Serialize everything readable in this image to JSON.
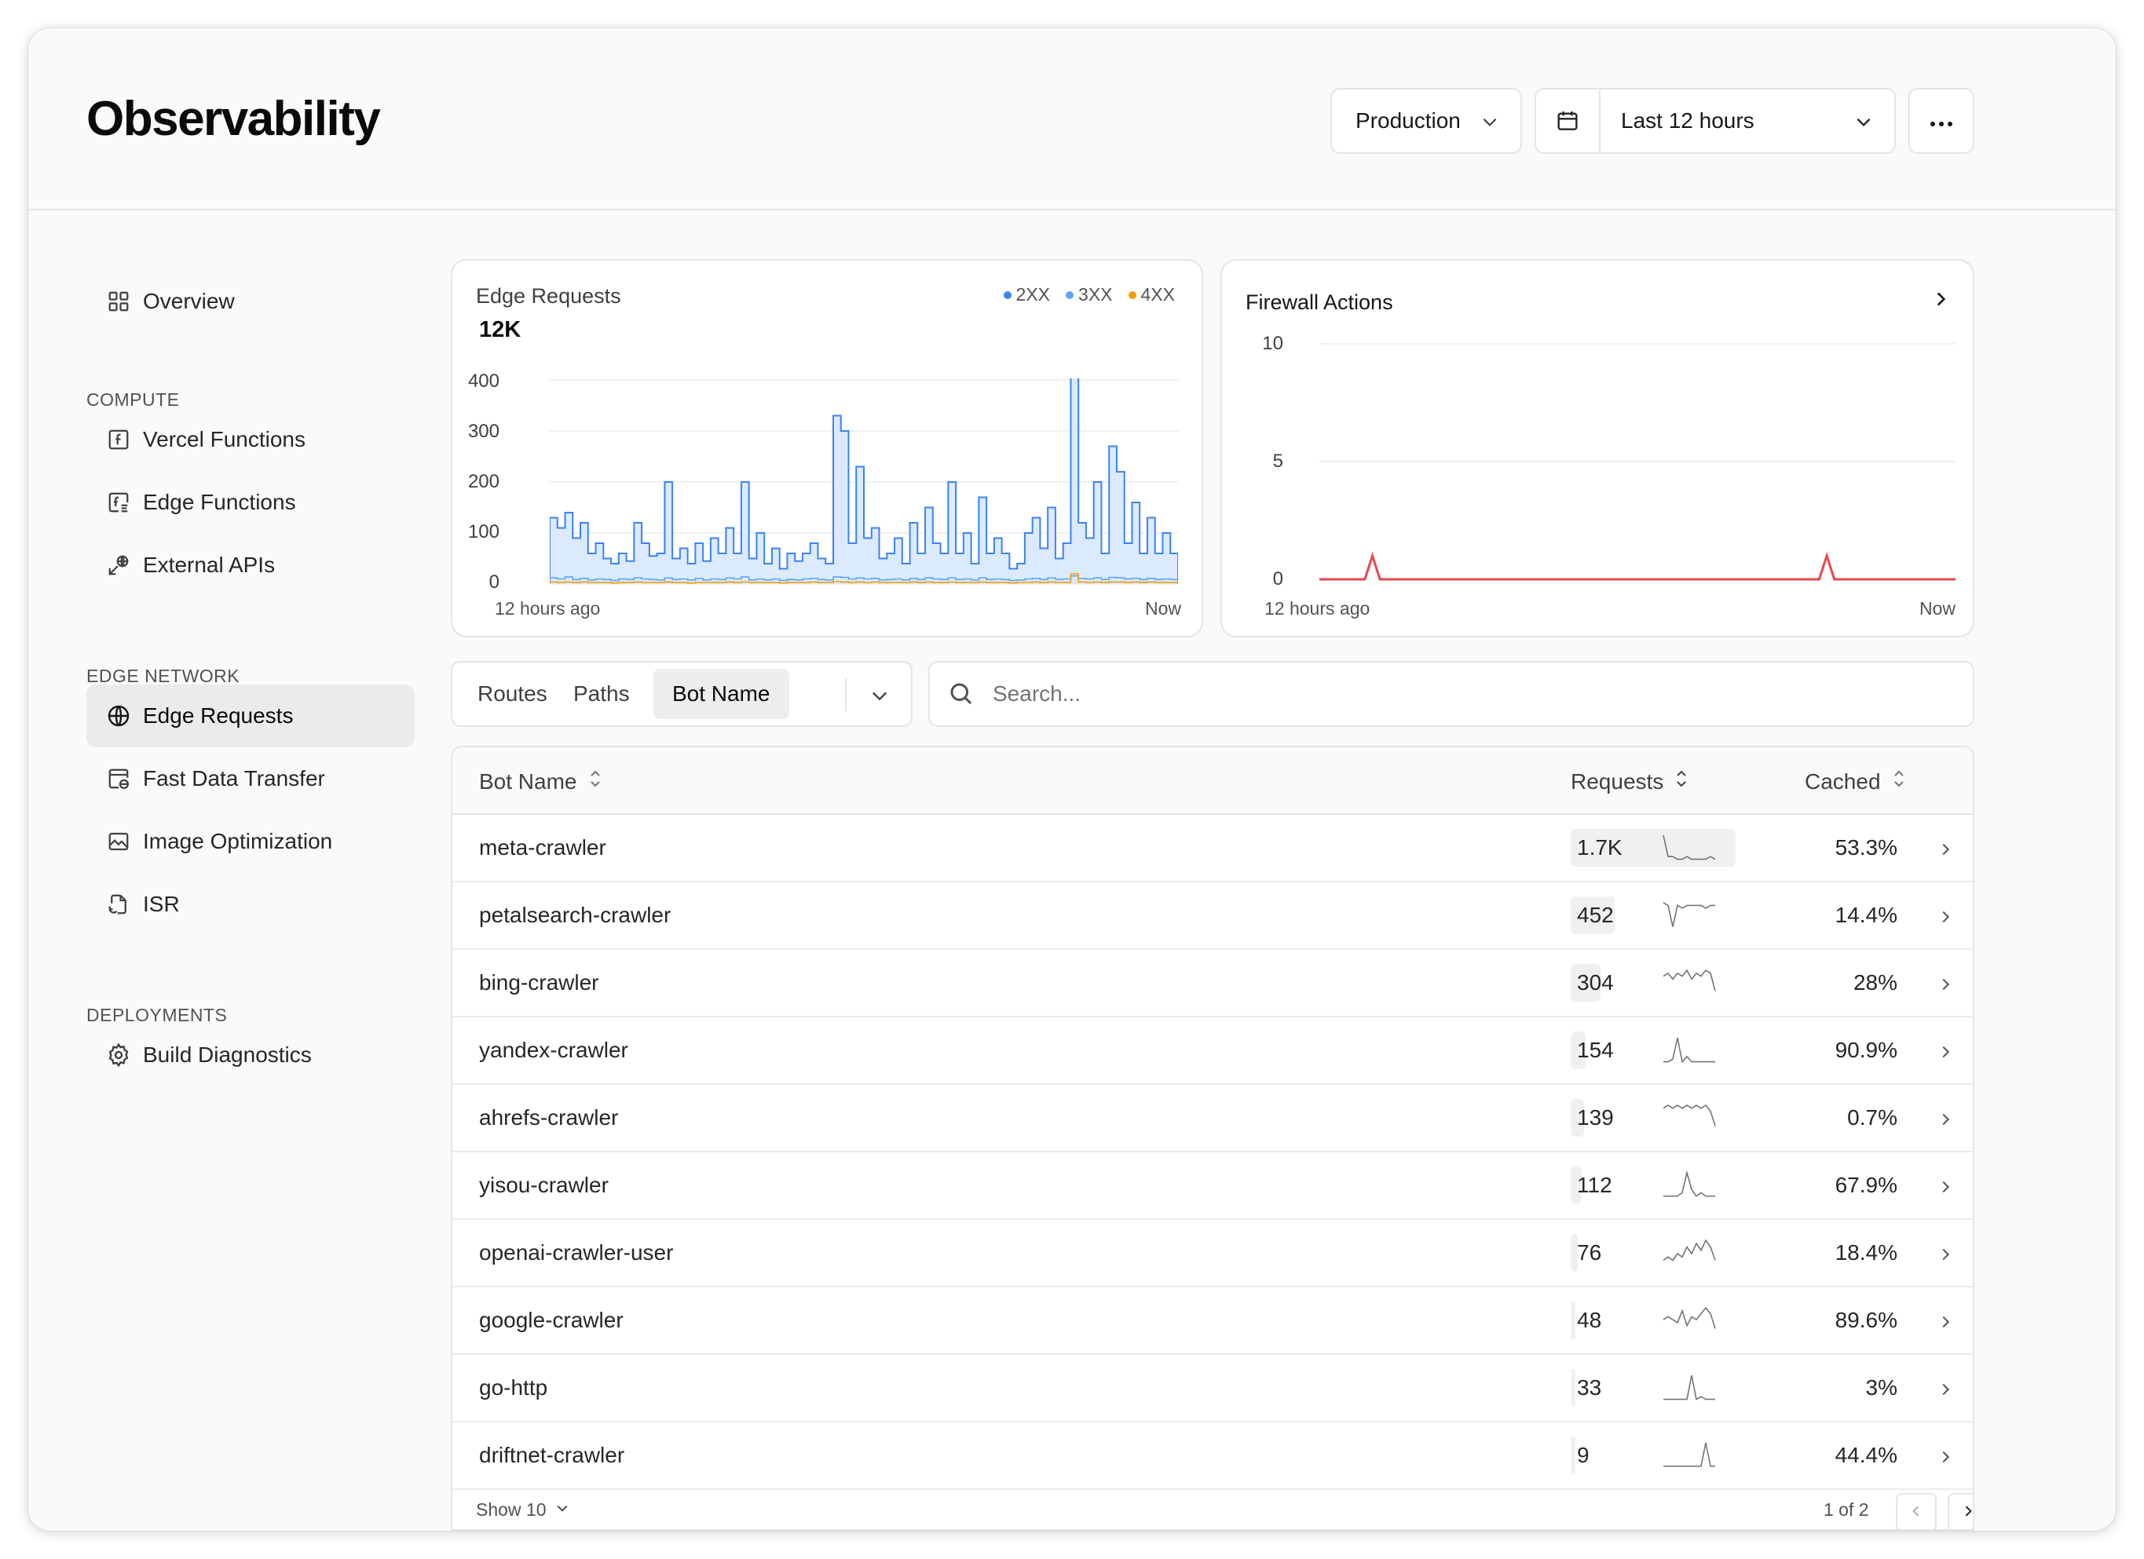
{
  "header": {
    "title": "Observability",
    "environment": "Production",
    "time_range": "Last 12 hours"
  },
  "sidebar": {
    "overview": "Overview",
    "sections": [
      {
        "label": "COMPUTE",
        "items": [
          "Vercel Functions",
          "Edge Functions",
          "External APIs"
        ]
      },
      {
        "label": "EDGE NETWORK",
        "items": [
          "Edge Requests",
          "Fast Data Transfer",
          "Image Optimization",
          "ISR"
        ]
      },
      {
        "label": "DEPLOYMENTS",
        "items": [
          "Build Diagnostics"
        ]
      }
    ],
    "active": "Edge Requests"
  },
  "edge_chart": {
    "title": "Edge Requests",
    "total": "12K",
    "legend": [
      {
        "label": "2XX",
        "color": "#3b82f6"
      },
      {
        "label": "3XX",
        "color": "#60a5fa"
      },
      {
        "label": "4XX",
        "color": "#f59e0b"
      }
    ],
    "y_ticks": [
      "400",
      "300",
      "200",
      "100",
      "0"
    ],
    "x_start": "12 hours ago",
    "x_end": "Now"
  },
  "firewall_chart": {
    "title": "Firewall Actions",
    "y_ticks": [
      "10",
      "5",
      "0"
    ],
    "x_start": "12 hours ago",
    "x_end": "Now",
    "color": "#e5484d"
  },
  "chart_data": [
    {
      "type": "area",
      "title": "Edge Requests",
      "ylim": [
        0,
        400
      ],
      "series": [
        {
          "name": "2XX",
          "values": [
            130,
            110,
            140,
            90,
            120,
            60,
            80,
            50,
            40,
            60,
            45,
            120,
            80,
            55,
            60,
            200,
            50,
            70,
            40,
            80,
            45,
            90,
            60,
            110,
            60,
            200,
            50,
            100,
            40,
            70,
            30,
            60,
            45,
            60,
            80,
            50,
            40,
            330,
            300,
            80,
            230,
            90,
            110,
            50,
            60,
            90,
            40,
            120,
            60,
            150,
            80,
            60,
            200,
            60,
            100,
            40,
            170,
            60,
            90,
            60,
            30,
            40,
            100,
            130,
            70,
            150,
            50,
            80,
            410,
            120,
            90,
            200,
            60,
            270,
            220,
            80,
            160,
            60,
            130,
            60,
            100,
            60
          ]
        },
        {
          "name": "3XX",
          "values": [
            12,
            10,
            14,
            9,
            11,
            8,
            10,
            9,
            7,
            10,
            9,
            12,
            10,
            9,
            8,
            12,
            9,
            10,
            8,
            11,
            8,
            10,
            9,
            12,
            10,
            14,
            8,
            10,
            8,
            10,
            7,
            9,
            8,
            10,
            11,
            9,
            8,
            14,
            13,
            10,
            12,
            10,
            11,
            8,
            9,
            10,
            8,
            11,
            9,
            12,
            10,
            9,
            12,
            9,
            10,
            8,
            12,
            9,
            10,
            9,
            7,
            8,
            10,
            11,
            9,
            12,
            9,
            10,
            16,
            11,
            10,
            12,
            9,
            13,
            12,
            10,
            11,
            9,
            11,
            9,
            10,
            9
          ]
        },
        {
          "name": "4XX",
          "values": [
            4,
            3,
            4,
            3,
            4,
            3,
            3,
            3,
            2,
            3,
            3,
            4,
            3,
            3,
            3,
            4,
            3,
            3,
            2,
            3,
            3,
            3,
            3,
            4,
            3,
            4,
            3,
            3,
            3,
            3,
            2,
            3,
            3,
            3,
            4,
            3,
            3,
            5,
            4,
            3,
            4,
            3,
            4,
            3,
            3,
            3,
            3,
            4,
            3,
            4,
            3,
            3,
            4,
            3,
            3,
            3,
            4,
            3,
            3,
            3,
            2,
            3,
            3,
            4,
            3,
            4,
            3,
            3,
            20,
            4,
            3,
            4,
            3,
            4,
            4,
            3,
            4,
            3,
            4,
            3,
            3,
            3
          ]
        }
      ]
    },
    {
      "type": "line",
      "title": "Firewall Actions",
      "ylim": [
        0,
        10
      ],
      "series": [
        {
          "name": "Firewall Actions",
          "values": [
            0,
            0,
            0,
            0,
            0,
            0,
            0,
            1,
            0,
            0,
            0,
            0,
            0,
            0,
            0,
            0,
            0,
            0,
            0,
            0,
            0,
            0,
            0,
            0,
            0,
            0,
            0,
            0,
            0,
            0,
            0,
            0,
            0,
            0,
            0,
            0,
            0,
            0,
            0,
            0,
            0,
            0,
            0,
            0,
            0,
            0,
            0,
            0,
            0,
            0,
            0,
            0,
            0,
            0,
            0,
            0,
            0,
            0,
            0,
            0,
            0,
            0,
            0,
            0,
            0,
            0,
            0,
            1,
            0,
            0,
            0,
            0,
            0,
            0,
            0,
            0,
            0,
            0,
            0,
            0,
            0,
            0,
            0,
            0,
            0
          ]
        }
      ]
    }
  ],
  "filters": {
    "tabs": [
      "Routes",
      "Paths",
      "Bot Name"
    ],
    "active": "Bot Name",
    "search_placeholder": "Search..."
  },
  "table": {
    "columns": {
      "name": "Bot Name",
      "requests": "Requests",
      "cached": "Cached"
    },
    "rows": [
      {
        "name": "meta-crawler",
        "requests": "1.7K",
        "req_num": 1700,
        "cached": "53.3%",
        "spark": [
          10,
          2,
          2,
          1,
          1,
          2,
          1,
          1,
          1,
          1,
          2,
          1
        ]
      },
      {
        "name": "petalsearch-crawler",
        "requests": "452",
        "req_num": 452,
        "cached": "14.4%",
        "spark": [
          10,
          9,
          1,
          9,
          8,
          9,
          9,
          9,
          9,
          8,
          9,
          9
        ]
      },
      {
        "name": "bing-crawler",
        "requests": "304",
        "req_num": 304,
        "cached": "28%",
        "spark": [
          7,
          8,
          6,
          8,
          7,
          9,
          6,
          8,
          7,
          9,
          8,
          2
        ]
      },
      {
        "name": "yandex-crawler",
        "requests": "154",
        "req_num": 154,
        "cached": "90.9%",
        "spark": [
          1,
          1,
          2,
          10,
          1,
          3,
          1,
          1,
          1,
          1,
          1,
          1
        ]
      },
      {
        "name": "ahrefs-crawler",
        "requests": "139",
        "req_num": 139,
        "cached": "0.7%",
        "spark": [
          8,
          9,
          8,
          9,
          8,
          9,
          8,
          9,
          8,
          9,
          7,
          2
        ]
      },
      {
        "name": "yisou-crawler",
        "requests": "112",
        "req_num": 112,
        "cached": "67.9%",
        "spark": [
          1,
          1,
          1,
          1,
          2,
          8,
          3,
          1,
          2,
          1,
          1,
          1
        ]
      },
      {
        "name": "openai-crawler-user",
        "requests": "76",
        "req_num": 76,
        "cached": "18.4%",
        "spark": [
          2,
          3,
          2,
          4,
          3,
          6,
          4,
          7,
          5,
          8,
          6,
          2
        ]
      },
      {
        "name": "google-crawler",
        "requests": "48",
        "req_num": 48,
        "cached": "89.6%",
        "spark": [
          5,
          6,
          5,
          4,
          8,
          3,
          6,
          5,
          7,
          9,
          7,
          2
        ]
      },
      {
        "name": "go-http",
        "requests": "33",
        "req_num": 33,
        "cached": "3%",
        "spark": [
          1,
          1,
          1,
          1,
          1,
          1,
          10,
          1,
          2,
          1,
          1,
          1
        ]
      },
      {
        "name": "driftnet-crawler",
        "requests": "9",
        "req_num": 9,
        "cached": "44.4%",
        "spark": [
          1,
          1,
          1,
          1,
          1,
          1,
          1,
          1,
          1,
          8,
          1,
          1
        ]
      }
    ],
    "show_label": "Show 10",
    "pagination": "1 of 2"
  }
}
